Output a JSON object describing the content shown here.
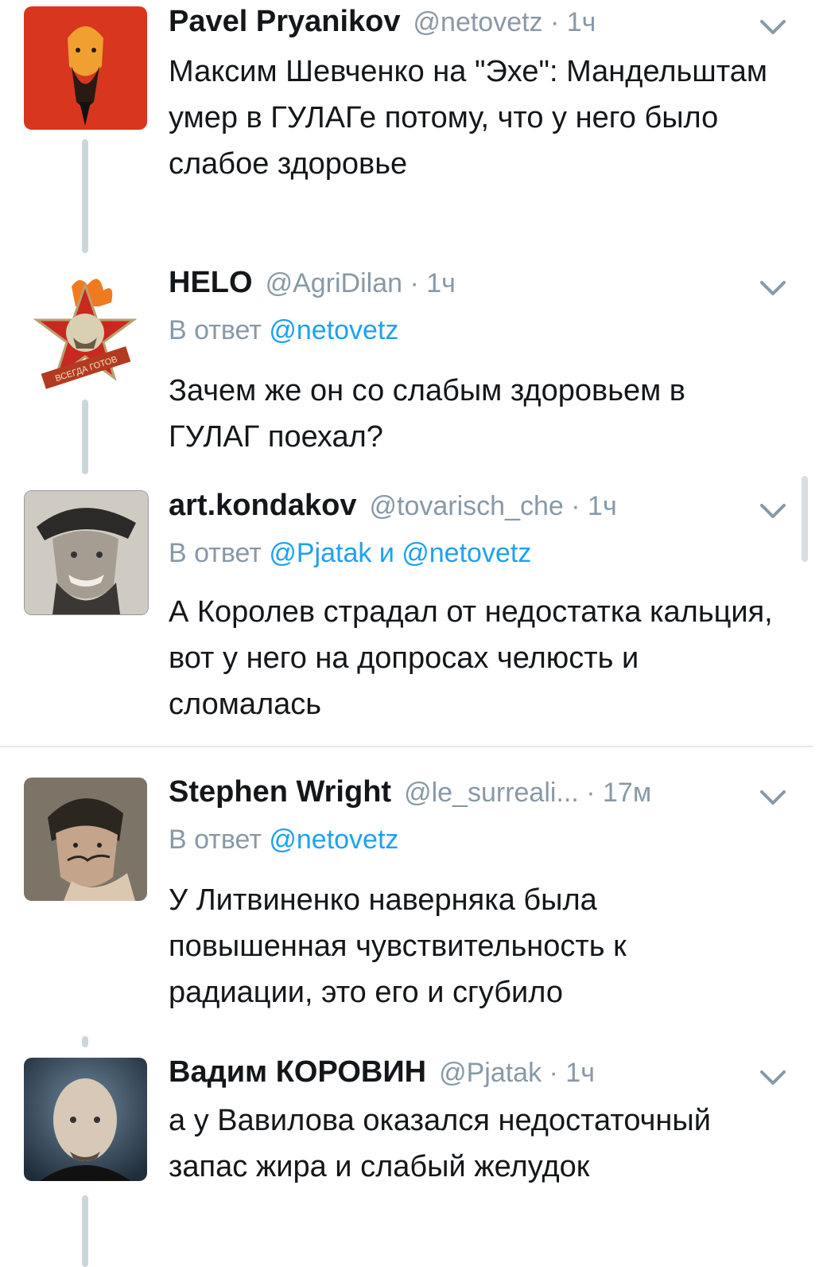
{
  "tweets": [
    {
      "name": "Pavel Pryanikov",
      "meta": "@netovetz · 1ч",
      "text": "Максим Шевченко на \"Эхе\": Мандельштам умер в ГУЛАГе потому, что у него было слабое здоровье",
      "avatar_icon": "portrait-red-icon"
    },
    {
      "name": "HELO",
      "meta": "@AgriDilan · 1ч",
      "reply_prefix": "В ответ",
      "reply_mention": "@netovetz",
      "text": "Зачем же он со слабым здоровьем в ГУЛАГ поехал?",
      "avatar_icon": "pioneer-badge-icon",
      "badge_text": "ВСЕГДА ГОТОВ"
    },
    {
      "name": "art.kondakov",
      "meta": "@tovarisch_che · 1ч",
      "reply_prefix": "В ответ",
      "reply_mention": "@Pjatak и @netovetz",
      "text": "А Королев страдал от недостатка кальция, вот у него на допросах челюсть и сломалась",
      "avatar_icon": "che-portrait-icon"
    },
    {
      "name": "Stephen Wright",
      "meta": "@le_surreali...  · 17м",
      "reply_prefix": "В ответ",
      "reply_mention": "@netovetz",
      "text": "У Литвиненко наверняка была повышенная чувствительность к радиации, это его и сгубило",
      "avatar_icon": "mustache-portrait-icon"
    },
    {
      "name": "Вадим КОРОВИН",
      "meta": "@Pjatak · 1ч",
      "text": "а у Вавилова оказался недостаточный запас жира и слабый желудок",
      "avatar_icon": "bald-man-portrait-icon"
    }
  ],
  "colors": {
    "text": "#14171a",
    "secondary": "#8899a6",
    "link": "#1da1f2",
    "thread_line": "#ccd6dd"
  }
}
